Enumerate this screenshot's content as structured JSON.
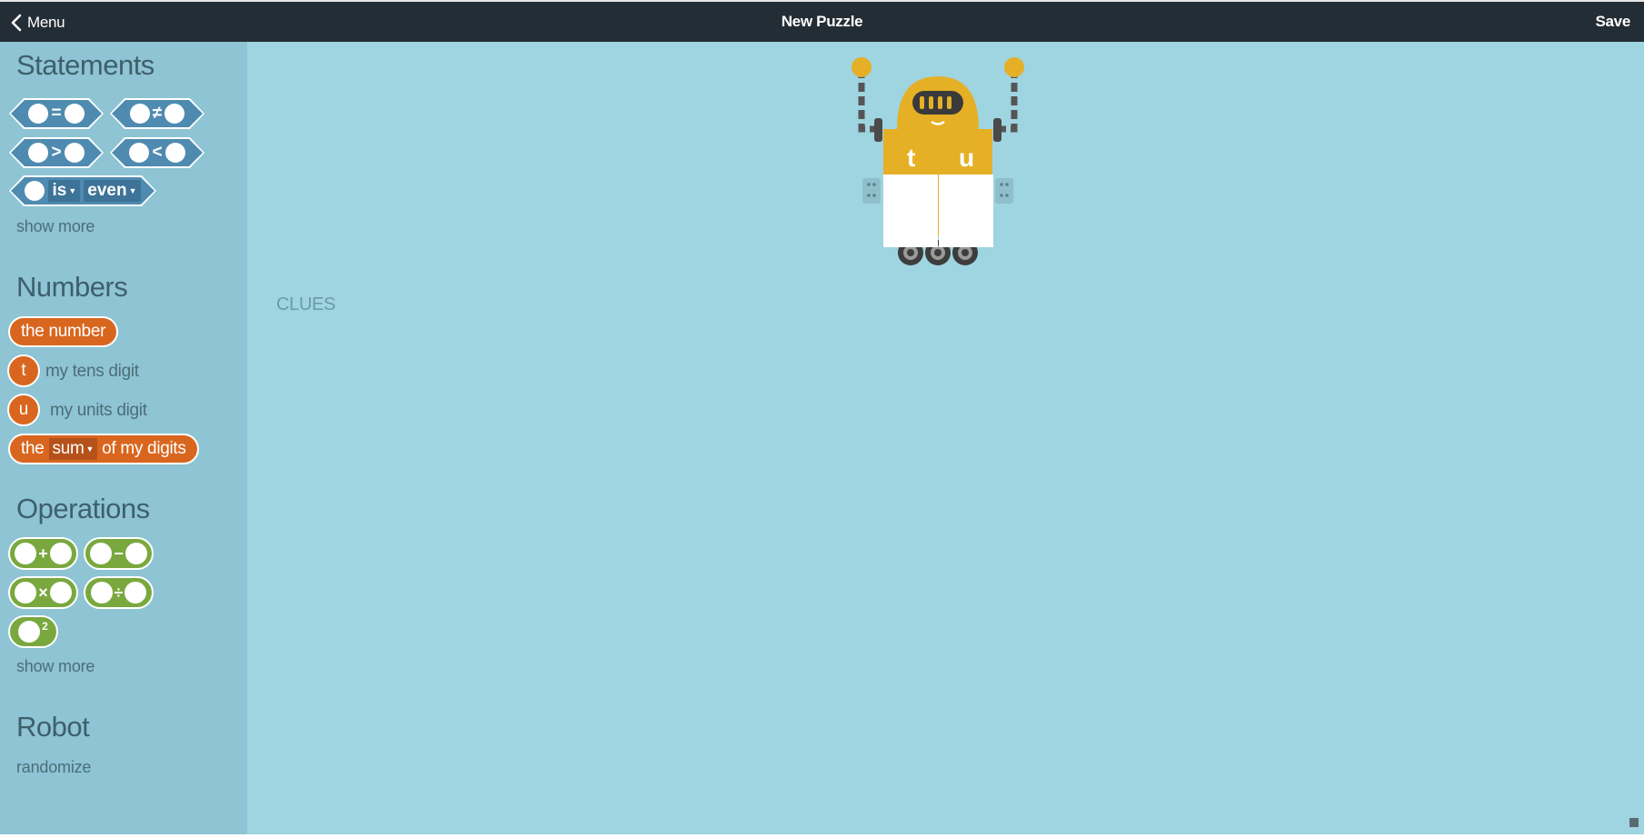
{
  "topbar": {
    "menu_label": "Menu",
    "title": "New Puzzle",
    "save_label": "Save"
  },
  "sidebar": {
    "statements": {
      "heading": "Statements",
      "blocks": [
        {
          "op": "="
        },
        {
          "op": "≠"
        },
        {
          "op": ">"
        },
        {
          "op": "<"
        }
      ],
      "is_block": {
        "is_label": "is",
        "parity_label": "even"
      },
      "show_more": "show more"
    },
    "numbers": {
      "heading": "Numbers",
      "the_number": "the number",
      "tens": {
        "letter": "t",
        "label": "my tens digit"
      },
      "units": {
        "letter": "u",
        "label": "my units digit"
      },
      "digits_block": {
        "prefix": "the",
        "func": "sum",
        "suffix": "of my digits"
      }
    },
    "operations": {
      "heading": "Operations",
      "blocks": [
        {
          "op": "+"
        },
        {
          "op": "−"
        },
        {
          "op": "×"
        },
        {
          "op": "÷"
        }
      ],
      "square_sup": "2",
      "show_more": "show more"
    },
    "robot": {
      "heading": "Robot",
      "randomize": "randomize"
    }
  },
  "main": {
    "robot_letters": {
      "tens": "t",
      "units": "u"
    },
    "clues_label": "CLUES"
  },
  "colors": {
    "topbar": "#232d35",
    "sidebar": "#8ec4d3",
    "main": "#9fd4e1",
    "statement_block": "#4f8bb0",
    "number_block": "#d9661f",
    "operation_block": "#79a83e",
    "robot_body": "#e5b026"
  },
  "icons": [
    "chevron-left-icon",
    "robot-illustration",
    "resize-handle-icon"
  ]
}
